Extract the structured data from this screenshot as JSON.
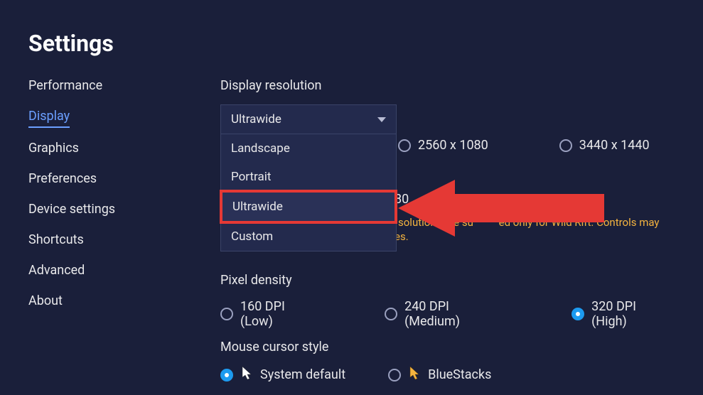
{
  "title": "Settings",
  "sidebar": {
    "items": [
      {
        "label": "Performance"
      },
      {
        "label": "Display",
        "active": true
      },
      {
        "label": "Graphics"
      },
      {
        "label": "Preferences"
      },
      {
        "label": "Device settings"
      },
      {
        "label": "Shortcuts"
      },
      {
        "label": "Advanced"
      },
      {
        "label": "About"
      }
    ]
  },
  "display_resolution": {
    "label": "Display resolution",
    "selected": "Ultrawide",
    "options": [
      "Landscape",
      "Portrait",
      "Ultrawide",
      "Custom"
    ],
    "highlighted_option": "Ultrawide",
    "resolutions": [
      "2560 x 1080",
      "3440 x 1440"
    ],
    "peek_resolution": "80",
    "warning_a": "solutions are su",
    "warning_b": "ed only for Wild Rift. Controls may",
    "warning_c": "es."
  },
  "pixel_density": {
    "label": "Pixel density",
    "options": [
      {
        "label": "160 DPI (Low)",
        "selected": false
      },
      {
        "label": "240 DPI (Medium)",
        "selected": false
      },
      {
        "label": "320 DPI (High)",
        "selected": true
      }
    ]
  },
  "cursor_style": {
    "label": "Mouse cursor style",
    "options": [
      {
        "label": "System default",
        "selected": true,
        "icon": "white"
      },
      {
        "label": "BlueStacks",
        "selected": false,
        "icon": "gold"
      }
    ]
  },
  "annotation": {
    "arrow_color": "#e53935"
  }
}
